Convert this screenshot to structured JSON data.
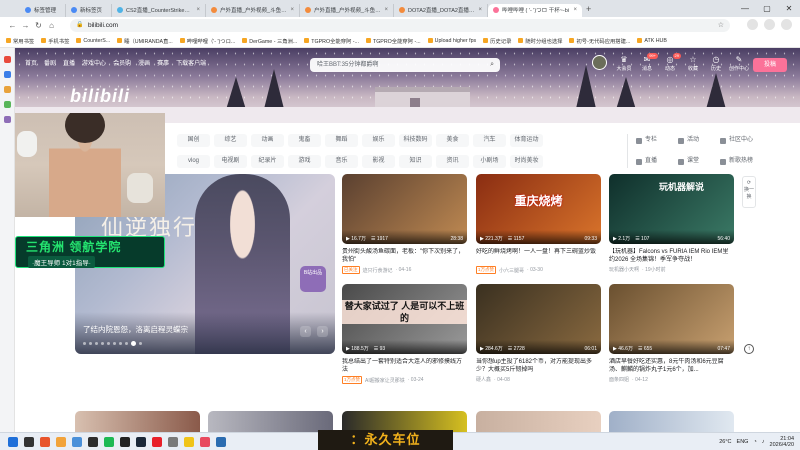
{
  "tabs": [
    {
      "title": "标签管理",
      "color": "#4a8af4"
    },
    {
      "title": "新标签页",
      "color": "#4a8af4"
    },
    {
      "title": "CS2直播_CounterStrike直播_CS2",
      "color": "#4fb3e6"
    },
    {
      "title": "户外直播_户外视频_斗鱼直播",
      "color": "#f38b3c"
    },
    {
      "title": "户外直播_户外视频_斗鱼直播",
      "color": "#f38b3c"
    },
    {
      "title": "DOTA2直播_DOTA2直播游戏视",
      "color": "#f38b3c"
    },
    {
      "title": "哔哩哔哩 ( '- ')つロ 干杯~-bi",
      "color": "#fb7299"
    }
  ],
  "address": "bilibili.com",
  "bookmarks": [
    "常用书签",
    "手机书签",
    "CounterS...",
    "睡（UMIRANDA直...",
    "哔哩哔哩（'- ')つロ...",
    "DerGame - 三角洲...",
    "TGPRO全能穿阿 -...",
    "TGPRO全能穿阿 -...",
    "Upload higher fps",
    "历史记录",
    "随时分组也选择",
    "初号-无代码应用搭建...",
    "ATK HUB"
  ],
  "site": {
    "logo": "bilibili",
    "nav": [
      "首页",
      "番剧",
      "直播",
      "游戏中心",
      "会员购",
      "漫画",
      "赛事",
      "下载客户端"
    ],
    "search_placeholder": "哈王BBT:35分钟都爵啊",
    "user_icons": [
      {
        "label": "大会员",
        "badge": ""
      },
      {
        "label": "消息",
        "badge": "99+"
      },
      {
        "label": "动态",
        "badge": "29"
      },
      {
        "label": "收藏",
        "badge": ""
      },
      {
        "label": "历史",
        "badge": ""
      },
      {
        "label": "创作中心",
        "badge": ""
      }
    ],
    "upload_label": "投稿",
    "categories": [
      "国创",
      "综艺",
      "动画",
      "鬼畜",
      "舞蹈",
      "娱乐",
      "科技数码",
      "美食",
      "汽车",
      "体育运动",
      "vlog",
      "电视剧",
      "纪录片",
      "游戏",
      "音乐",
      "影视",
      "知识",
      "资讯",
      "小剧场",
      "时尚美妆",
      "动物",
      "更多"
    ],
    "right_links": [
      "专栏",
      "活动",
      "社区中心",
      "直播",
      "课堂",
      "新歌热榜"
    ]
  },
  "carousel": {
    "title": "了结内院恩怨，洛离启程灵蝶宗",
    "badge": "B站出品",
    "art_title": "仙逆独行",
    "dot_count": 10,
    "active_dot": 8
  },
  "webcam": {
    "promo_line1": "三角洲 领航学院",
    "promo_line2": "·魔王导师 1对1指导·"
  },
  "refresh_label": "换一换",
  "videos": [
    {
      "views": "16.7万",
      "danmaku": "1917",
      "duration": "28:38",
      "title": "贵州街头酸汤鱼碳面，老板：\"你下次别来了，我怕\"",
      "up": "迹只行食游记",
      "date": "04-16",
      "up_tag": "已关注",
      "overlay": "",
      "colors": [
        "#5a4030",
        "#c08a52"
      ]
    },
    {
      "views": "221.3万",
      "danmaku": "1157",
      "duration": "09:33",
      "title": "好吃的鲜烧烤啊！一人一盘！再下三碗蓝炒饭",
      "up": "小六三腿哥",
      "date": "03-30",
      "up_tag": "1万点赞",
      "overlay": "重庆烧烤",
      "colors": [
        "#8a2d12",
        "#d9742b"
      ]
    },
    {
      "views": "2.1万",
      "danmaku": "107",
      "duration": "56:40",
      "title": "【玩机器】Falcons vs FURIA IEM Rio IEM里约2026 全场集锦！季军争夺战！",
      "up": "玩机器小天啊",
      "date": "19小时前",
      "up_tag": "",
      "overlay": "玩机器解说",
      "colors": [
        "#0f2f2b",
        "#3b7a66"
      ]
    },
    {
      "views": "188.5万",
      "danmaku": "93",
      "duration": "",
      "title": "我总结出了一套特别适合大连人的邪修摸线方法",
      "up": "AI超搬家让灵那铁",
      "date": "03-24",
      "up_tag": "1万点赞",
      "overlay": "替大家试过了 人是可以不上班的",
      "colors": [
        "#4a4a4a",
        "#9a9a9a"
      ]
    },
    {
      "views": "284.6万",
      "danmaku": "2728",
      "duration": "06:01",
      "title": "当你想up主投了6182个币，对方能提现出多少？大概买5斤韧掉吗",
      "up": "硬人鑫",
      "date": "04-08",
      "up_tag": "",
      "overlay": "",
      "colors": [
        "#3a3020",
        "#8a6a40"
      ]
    },
    {
      "views": "46.6万",
      "danmaku": "655",
      "duration": "07:47",
      "title": "酒店早餐好吃还实惠，8元牛肉汤和6元豆腐汤、麒麟的锅炸丸子1元6个，加...",
      "up": "面条四姐",
      "date": "04-12",
      "up_tag": "",
      "overlay": "",
      "colors": [
        "#6a5030",
        "#c8a070"
      ]
    }
  ],
  "bottom_banner": "：永久车位",
  "taskbar": {
    "time": "21:04",
    "date": "2026/4/20",
    "lang": "ENG",
    "temp": "26°C"
  }
}
